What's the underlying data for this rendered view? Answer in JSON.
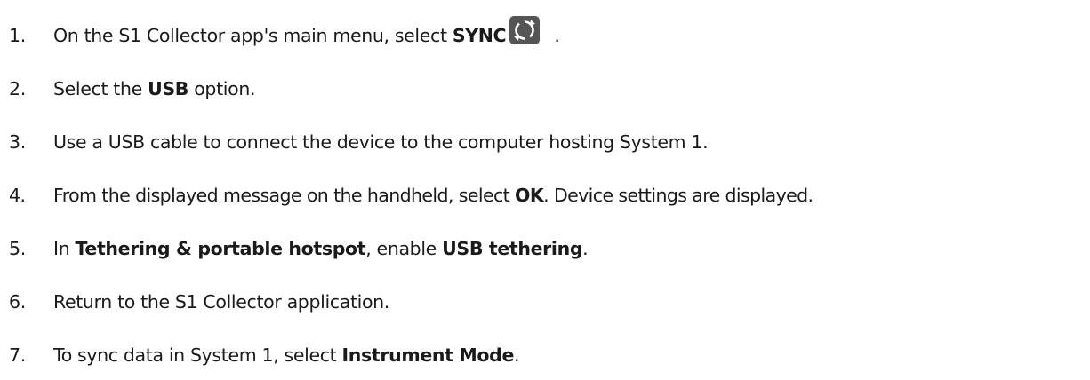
{
  "steps": [
    {
      "number": "1.",
      "before": "On the S1 Collector app's main menu, select ",
      "bold": "SYNC",
      "after": " .",
      "icon": "sync-icon"
    },
    {
      "number": "2.",
      "before": "Select the ",
      "bold": "USB",
      "after": " option."
    },
    {
      "number": "3.",
      "text": "Use a USB cable to connect the device to the computer hosting System 1."
    },
    {
      "number": "4.",
      "before": "From the displayed message on the handheld, select ",
      "bold": "OK",
      "after": ". Device settings are displayed."
    },
    {
      "number": "5.",
      "before": "In ",
      "bold": "Tethering & portable hotspot",
      "middle": ", enable ",
      "bold2": "USB tethering",
      "after": "."
    },
    {
      "number": "6.",
      "text": "Return to the S1 Collector application."
    },
    {
      "number": "7.",
      "before": "To sync data in System 1, select ",
      "bold": "Instrument Mode",
      "after": "."
    }
  ],
  "colors": {
    "text": "#1a1a1a",
    "icon_fill": "#555555"
  }
}
